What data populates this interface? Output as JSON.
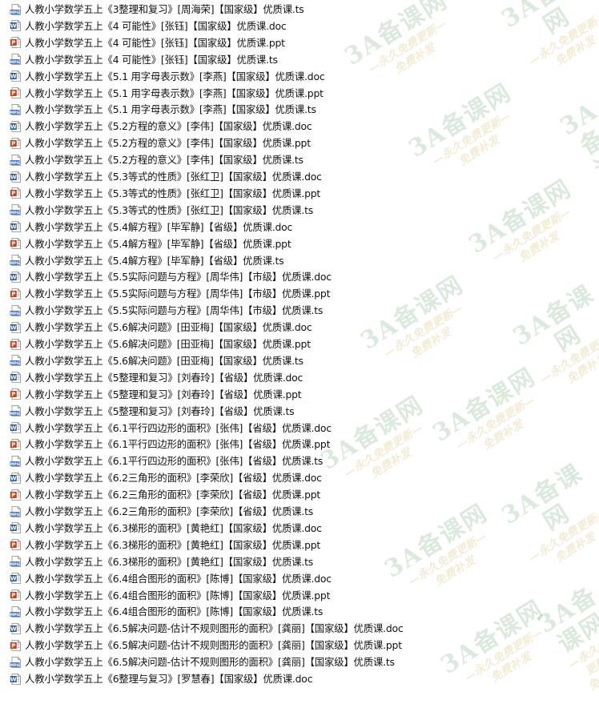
{
  "files": [
    {
      "name": "人教小学数学五上《3整理和复习》[周海荣]【国家级】优质课.ts",
      "type": "ts"
    },
    {
      "name": "人教小学数学五上《4 可能性》[张钰]【国家级】优质课.doc",
      "type": "doc"
    },
    {
      "name": "人教小学数学五上《4 可能性》[张钰]【国家级】优质课.ppt",
      "type": "ppt"
    },
    {
      "name": "人教小学数学五上《4 可能性》[张钰]【国家级】优质课.ts",
      "type": "ts"
    },
    {
      "name": "人教小学数学五上《5.1 用字母表示数》[李燕]【国家级】优质课.doc",
      "type": "doc"
    },
    {
      "name": "人教小学数学五上《5.1 用字母表示数》[李燕]【国家级】优质课.ppt",
      "type": "ppt"
    },
    {
      "name": "人教小学数学五上《5.1 用字母表示数》[李燕]【国家级】优质课.ts",
      "type": "ts"
    },
    {
      "name": "人教小学数学五上《5.2方程的意义》[李伟]【国家级】优质课.doc",
      "type": "doc"
    },
    {
      "name": "人教小学数学五上《5.2方程的意义》[李伟]【国家级】优质课.ppt",
      "type": "ppt"
    },
    {
      "name": "人教小学数学五上《5.2方程的意义》[李伟]【国家级】优质课.ts",
      "type": "ts"
    },
    {
      "name": "人教小学数学五上《5.3等式的性质》[张红卫]【国家级】优质课.doc",
      "type": "doc"
    },
    {
      "name": "人教小学数学五上《5.3等式的性质》[张红卫]【国家级】优质课.ppt",
      "type": "ppt"
    },
    {
      "name": "人教小学数学五上《5.3等式的性质》[张红卫]【国家级】优质课.ts",
      "type": "ts"
    },
    {
      "name": "人教小学数学五上《5.4解方程》[毕军静]【省级】优质课.doc",
      "type": "doc"
    },
    {
      "name": "人教小学数学五上《5.4解方程》[毕军静]【省级】优质课.ppt",
      "type": "ppt"
    },
    {
      "name": "人教小学数学五上《5.4解方程》[毕军静]【省级】优质课.ts",
      "type": "ts"
    },
    {
      "name": "人教小学数学五上《5.5实际问题与方程》[周华伟]【市级】优质课.doc",
      "type": "doc"
    },
    {
      "name": "人教小学数学五上《5.5实际问题与方程》[周华伟]【市级】优质课.ppt",
      "type": "ppt"
    },
    {
      "name": "人教小学数学五上《5.5实际问题与方程》[周华伟]【市级】优质课.ts",
      "type": "ts"
    },
    {
      "name": "人教小学数学五上《5.6解决问题》[田亚梅]【国家级】优质课.doc",
      "type": "doc"
    },
    {
      "name": "人教小学数学五上《5.6解决问题》[田亚梅]【国家级】优质课.ppt",
      "type": "ppt"
    },
    {
      "name": "人教小学数学五上《5.6解决问题》[田亚梅]【国家级】优质课.ts",
      "type": "ts"
    },
    {
      "name": "人教小学数学五上《5整理和复习》[刘春玲]【省级】优质课.doc",
      "type": "doc"
    },
    {
      "name": "人教小学数学五上《5整理和复习》[刘春玲]【省级】优质课.ppt",
      "type": "ppt"
    },
    {
      "name": "人教小学数学五上《5整理和复习》[刘春玲]【省级】优质课.ts",
      "type": "ts"
    },
    {
      "name": "人教小学数学五上《6.1平行四边形的面积》[张伟]【省级】优质课.doc",
      "type": "doc"
    },
    {
      "name": "人教小学数学五上《6.1平行四边形的面积》[张伟]【省级】优质课.ppt",
      "type": "ppt"
    },
    {
      "name": "人教小学数学五上《6.1平行四边形的面积》[张伟]【省级】优质课.ts",
      "type": "ts"
    },
    {
      "name": "人教小学数学五上《6.2三角形的面积》[李荣欣]【省级】优质课.doc",
      "type": "doc"
    },
    {
      "name": "人教小学数学五上《6.2三角形的面积》[李荣欣]【省级】优质课.ppt",
      "type": "ppt"
    },
    {
      "name": "人教小学数学五上《6.2三角形的面积》[李荣欣]【省级】优质课.ts",
      "type": "ts"
    },
    {
      "name": "人教小学数学五上《6.3梯形的面积》[黄艳红]【国家级】优质课.doc",
      "type": "doc"
    },
    {
      "name": "人教小学数学五上《6.3梯形的面积》[黄艳红]【国家级】优质课.ppt",
      "type": "ppt"
    },
    {
      "name": "人教小学数学五上《6.3梯形的面积》[黄艳红]【国家级】优质课.ts",
      "type": "ts"
    },
    {
      "name": "人教小学数学五上《6.4组合图形的面积》[陈博]【国家级】优质课.doc",
      "type": "doc"
    },
    {
      "name": "人教小学数学五上《6.4组合图形的面积》[陈博]【国家级】优质课.ppt",
      "type": "ppt"
    },
    {
      "name": "人教小学数学五上《6.4组合图形的面积》[陈博]【国家级】优质课.ts",
      "type": "ts"
    },
    {
      "name": "人教小学数学五上《6.5解决问题-估计不规则图形的面积》[龚丽]【国家级】优质课.doc",
      "type": "doc"
    },
    {
      "name": "人教小学数学五上《6.5解决问题-估计不规则图形的面积》[龚丽]【国家级】优质课.ppt",
      "type": "ppt"
    },
    {
      "name": "人教小学数学五上《6.5解决问题-估计不规则图形的面积》[龚丽]【国家级】优质课.ts",
      "type": "ts"
    },
    {
      "name": "人教小学数学五上《6整理与复习》[罗慧春]【国家级】优质课.doc",
      "type": "doc"
    }
  ],
  "icons": {
    "doc": {
      "name": "word-document-icon",
      "color": "#2b5797",
      "label": "W"
    },
    "ppt": {
      "name": "powerpoint-document-icon",
      "color": "#c8441c",
      "label": "P"
    },
    "ts": {
      "name": "video-file-icon",
      "color": "#4a7bd0",
      "label": "MPG"
    }
  },
  "watermark": {
    "main_text": "3A备课网",
    "sub_text": "—永久免费更新—",
    "sub_text2": "免费补发",
    "main_color": "#2e7d32",
    "sub_color": "#b8860b"
  }
}
